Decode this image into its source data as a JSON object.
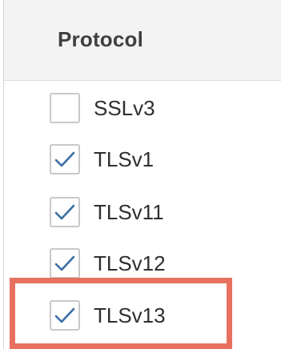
{
  "table": {
    "column_header": "Protocol",
    "rows": [
      {
        "label": "SSLv3",
        "checked": false
      },
      {
        "label": "TLSv1",
        "checked": true
      },
      {
        "label": "TLSv11",
        "checked": true
      },
      {
        "label": "TLSv12",
        "checked": true
      },
      {
        "label": "TLSv13",
        "checked": true
      }
    ]
  },
  "colors": {
    "check": "#3a6ea5",
    "highlight": "#e8705f"
  }
}
